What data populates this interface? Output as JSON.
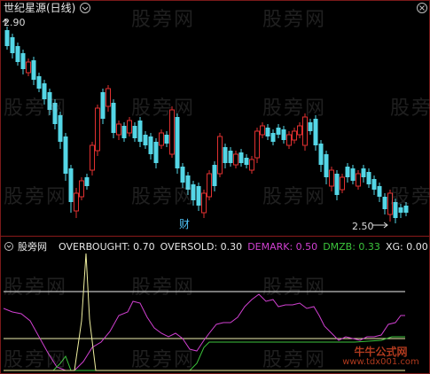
{
  "header": {
    "title": "世纪星源(日线)",
    "arrow_icon": "circle-chevron-down-icon",
    "close_icon": "close-icon"
  },
  "price_labels": {
    "high": "2.90",
    "low": "2.50",
    "marker": "财"
  },
  "indicator": {
    "name": "股旁网",
    "params": [
      {
        "label": "OVERBOUGHT:",
        "value": "0.70",
        "color": "#e6e6e6"
      },
      {
        "label": "OVERSOLD:",
        "value": "0.30",
        "color": "#e6e6e6"
      },
      {
        "label": "DEMARK:",
        "value": "0.50",
        "color": "#d040d0"
      },
      {
        "label": "DMZB:",
        "value": "0.33",
        "color": "#3cc43c"
      },
      {
        "label": "XG:",
        "value": "0.00",
        "color": "#e6e6e6"
      }
    ]
  },
  "watermark": "股旁网",
  "corner_watermark": {
    "line1": "牛牛公式网",
    "line2": "www.tdx001.com"
  },
  "colors": {
    "up": "#e03030",
    "down": "#54d6e6",
    "ma_white": "#e0e0e0",
    "overbought_line": "#f0f0f0",
    "oversold_line": "#f0f0b0",
    "demark": "#d040d0",
    "dmzb": "#3cc43c",
    "xg": "#f0f0a0"
  }
}
